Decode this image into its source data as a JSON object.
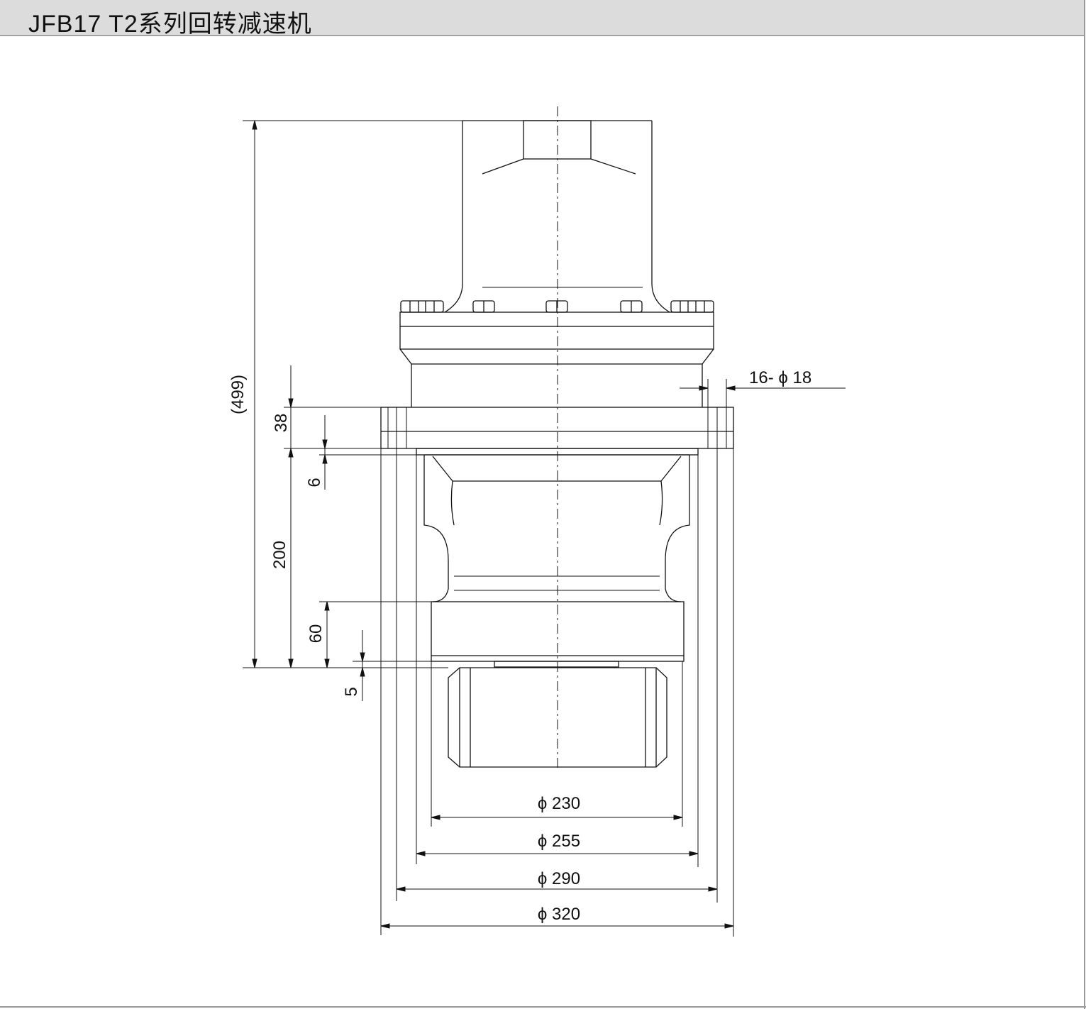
{
  "header": {
    "title": "JFB17 T2系列回转减速机"
  },
  "dimensions": {
    "vertical": {
      "overall": "(499)",
      "flange_thickness": "38",
      "spigot": "6",
      "body_height": "200",
      "base_height": "60",
      "base_gap": "5"
    },
    "holes": "16- ϕ 18",
    "diameters": {
      "d230": "ϕ 230",
      "d255": "ϕ 255",
      "d290": "ϕ 290",
      "d320": "ϕ 320"
    }
  }
}
